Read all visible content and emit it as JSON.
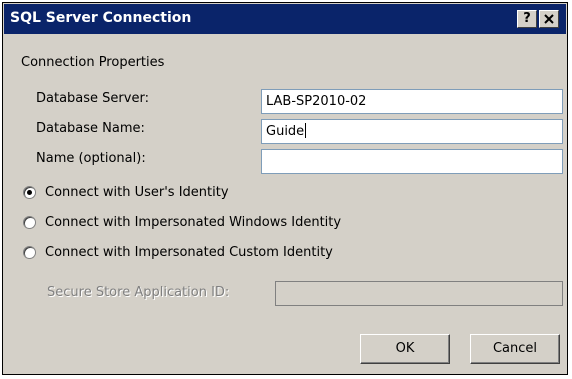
{
  "dialog": {
    "title": "SQL Server Connection",
    "help_label": "?",
    "section_label": "Connection Properties"
  },
  "fields": [
    {
      "label": "Database Server:",
      "value": "LAB-SP2010-02"
    },
    {
      "label": "Database Name:",
      "value": "Guide"
    },
    {
      "label": "Name (optional):",
      "value": ""
    }
  ],
  "identity_options": [
    {
      "label": "Connect with User's Identity",
      "selected": true
    },
    {
      "label": "Connect with Impersonated Windows Identity",
      "selected": false
    },
    {
      "label": "Connect with Impersonated Custom Identity",
      "selected": false
    }
  ],
  "secure_store": {
    "label": "Secure Store Application ID:",
    "value": "",
    "enabled": false
  },
  "buttons": {
    "ok_label": "OK",
    "cancel_label": "Cancel"
  },
  "icons": {
    "help": "help-icon",
    "close": "close-icon"
  },
  "colors": {
    "titlebar": "#0a246a",
    "dialog_bg": "#d4d0c8",
    "field_border": "#7f9db9"
  }
}
